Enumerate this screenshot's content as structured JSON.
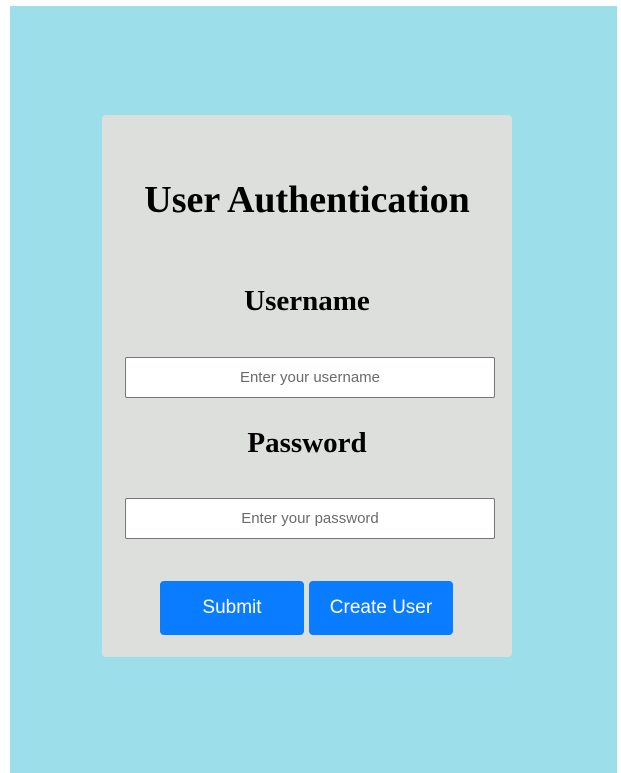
{
  "auth_form": {
    "title": "User Authentication",
    "username_label": "Username",
    "username_placeholder": "Enter your username",
    "username_value": "",
    "password_label": "Password",
    "password_placeholder": "Enter your password",
    "password_value": "",
    "submit_label": "Submit",
    "create_user_label": "Create User"
  },
  "colors": {
    "page_background": "#9ddeeb",
    "card_background": "#dcdfdc",
    "button_background": "#0a7cff",
    "button_text": "#ffffff"
  }
}
